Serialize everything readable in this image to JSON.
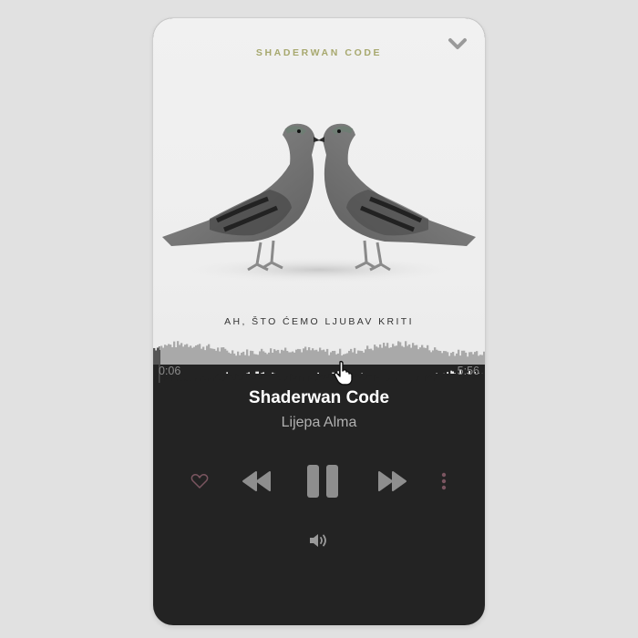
{
  "artwork": {
    "brand_text": "SHADERWAN CODE",
    "album_title": "AH, ŠTO ĆEMO LJUBAV KRITI"
  },
  "playback": {
    "current_time": "0:06",
    "total_time": "5:56",
    "progress": 0.017
  },
  "track": {
    "title": "Shaderwan Code",
    "artist": "Lijepa Alma"
  },
  "icons": {
    "collapse": "chevron-down-icon",
    "like": "heart-outline-icon",
    "previous": "rewind-icon",
    "play_pause": "pause-icon",
    "next": "fast-forward-icon",
    "more": "more-vertical-icon",
    "volume": "volume-icon",
    "cursor": "hand-pointer-icon"
  },
  "colors": {
    "brand": "#a7a86e",
    "background_dark": "#232323",
    "controls": "#8e8e8e",
    "accent_like": "#7a5560",
    "waveform_played": "#555555",
    "waveform_unplayed": "#a9a9a9"
  }
}
